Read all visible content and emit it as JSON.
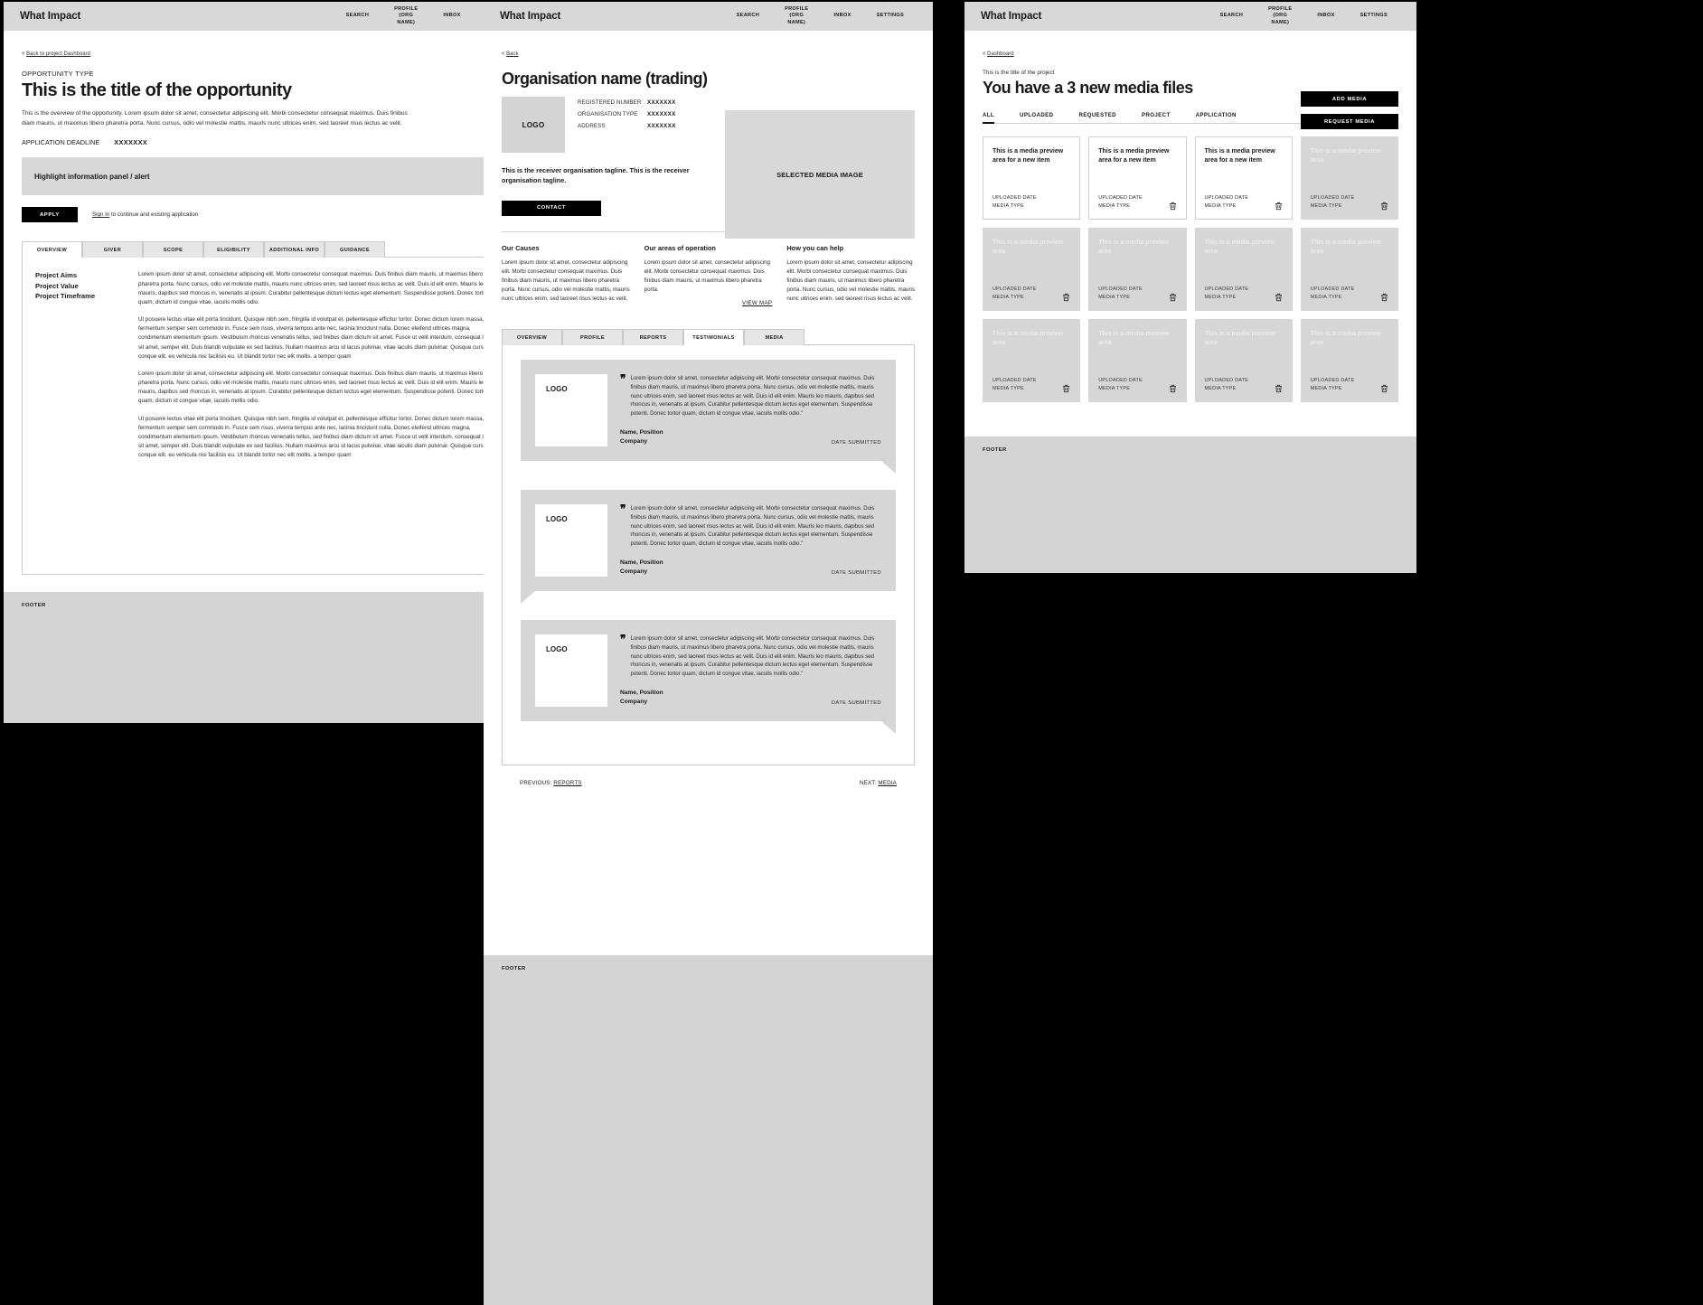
{
  "brand": "What Impact",
  "topnav": [
    "SEARCH",
    "PROFILE\n(ORG\nNAME)",
    "INBOX",
    "SETTINGS"
  ],
  "footer_label": "FOOTER",
  "panel1": {
    "back": "Back to project Dashboard",
    "eyebrow": "OPPORTUNITY TYPE",
    "title": "This is the title of the opportunity",
    "lead": "This is the overview of the opportunity. Lorem ipsum dolor sit amet, consectetur adipiscing elit. Morbi consectetur consequat maximus. Duis finibus diam mauris, ut maximus libero pharetra porta. Nunc cursus, odio vel molestie mattis, mauris nunc ultrices enim, sed laoreet risus lectus ac velit.",
    "deadline_label": "APPLICATION DEADLINE",
    "deadline_value": "XXXXXXX",
    "alert": "Highlight information panel / alert",
    "apply_label": "APPLY",
    "signin_link": "Sign In",
    "signin_rest": " to continue and existing application",
    "tabs": [
      "OVERVIEW",
      "GIVER",
      "SCOPE",
      "ELIGIBILITY",
      "ADDITIONAL INFO",
      "GUIDANCE"
    ],
    "active_tab": "OVERVIEW",
    "labels": [
      "Project Aims",
      "Project Value",
      "Project Timeframe"
    ],
    "paragraphs": [
      "Lorem ipsum dolor sit amet, consectetur adipiscing elit. Morbi consectetur consequat maximus. Duis finibus diam mauris, ut maximus libero pharetra porta. Nunc cursus, odio vel molestie mattis, mauris nunc ultrices enim, sed laoreet risus lectus ac velit. Duis id elit enim. Mauris leo mauris, dapibus sed rhoncus in, venenatis at ipsum. Curabitur pellentesque dictum lectus eget elementum. Suspendisse potenti. Donec tortor quam, dictum id congue vitae, iaculis mollis odio.",
      "Ut posuere lectus vitae elit porta tincidunt. Quisque nibh sem, fringilla id volutpat et, pellentesque efficitur tortor. Donec dictum lorem massa, fermentum semper sem commodo in. Fusce sem risus, viverra tempus ante nec, lacinia tincidunt nulla. Donec eleifend ultrices magna, condimentum elementum ipsum. Vestibulum rhoncus venenatis tellus, sed finibus diam dictum sit amet. Fusce ut velit interdum, consequat lectus sit amet, semper elit. Duis blandit vulputate ex sed facilisis. Nullam maximus arcu id lacus pulvinar, vitae iaculis diam pulvinar. Quisque cursus conque elit. eu vehicula nisi facilisis eu. Ut blandit tortor nec elit mollis. a tempor quam",
      "Lorem ipsum dolor sit amet, consectetur adipiscing elit. Morbi consectetur consequat maximus. Duis finibus diam mauris, ut maximus libero pharetra porta. Nunc cursus, odio vel molestie mattis, mauris nunc ultrices enim, sed laoreet risus lectus ac velit. Duis id elit enim. Mauris leo mauris, dapibus sed rhoncus in, venenatis at ipsum. Curabitur pellentesque dictum lectus eget elementum. Suspendisse potenti. Donec tortor quam, dictum id congue vitae, iaculis mollis odio.",
      "Ut posuere lectus vitae elit porta tincidunt. Quisque nibh sem, fringilla id volutpat et, pellentesque efficitur tortor. Donec dictum lorem massa, fermentum semper sem commodo in. Fusce sem risus, viverra tempus ante nec, lacinia tincidunt nulla. Donec eleifend ultrices magna, condimentum elementum ipsum. Vestibulum rhoncus venenatis tellus, sed finibus diam dictum sit amet. Fusce ut velit interdum, consequat lectus sit amet, semper elit. Duis blandit vulputate ex sed facilisis. Nullam maximus arcu id lacus pulvinar, vitae iaculis diam pulvinar. Quisque cursus conque elit. eu vehicula nisi facilisis eu. Ut blandit tortor nec elit mollis. a tempor quam"
    ]
  },
  "panel2": {
    "back": "Back",
    "title": "Organisation name (trading)",
    "logo_label": "LOGO",
    "meta": [
      {
        "key": "REGISTERED NUMBER",
        "value": "XXXXXXX"
      },
      {
        "key": "ORGANISATION TYPE",
        "value": "XXXXXXX"
      },
      {
        "key": "ADDRESS",
        "value": "XXXXXXX"
      }
    ],
    "media_image_label": "SELECTED MEDIA IMAGE",
    "tagline": "This is the receiver organisation tagline. This is the receiver organisation tagline.",
    "contact_label": "CONTACT",
    "columns": [
      {
        "heading": "Our Causes",
        "body": "Lorem ipsum dolor sit amet, consectetur adipiscing elit. Morbi consectetur consequat maximus. Duis finibus diam mauris, ut maximus libero pharetra porta. Nunc cursus, odio vel molestie mattis, mauris nunc ultrices enim, sed laoreet risus lectus ac velit."
      },
      {
        "heading": "Our areas of operation",
        "body": "Lorem ipsum dolor sit amet, consectetur adipiscing elit. Morbi consectetur consequat maximus. Duis finibus diam mauris, ut maximus libero pharetra porta.",
        "link": "VIEW MAP"
      },
      {
        "heading": "How you can help",
        "body": "Lorem ipsum dolor sit amet, consectetur adipiscing elit. Morbi consectetur consequat maximus. Duis finibus diam mauris, ut maximus libero pharetra porta. Nunc cursus, odio vel molestie mattis, mauris nunc ultrices enim, sed laoreet risus lectus ac velit."
      }
    ],
    "tabs": [
      "OVERVIEW",
      "PROFILE",
      "REPORTS",
      "TESTIMONIALS",
      "MEDIA"
    ],
    "active_tab": "TESTIMONIALS",
    "testimonial_quote": "Lorem ipsum dolor sit amet, consectetur adipiscing elit. Morbi consectetur consequat maximus. Duis finibus diam mauris, ut maximus libero pharetra porta. Nunc cursus, odio vel molestie mattis, mauris nunc ultrices enim, sed laoreet risus lectus ac velit. Duis id elit enim. Mauris leo mauris, dapibus sed rhoncus in, venenatis at ipsum. Curabitur pellentesque dictum lectus eget elementum. Suspendisse potenti. Donec tortor quam, dictum id congue vitae, iaculis mollis odio.\"",
    "testimonials": [
      {
        "logo": "LOGO",
        "name": "Name, Position",
        "company": "Company",
        "date": "DATE SUBMITTED",
        "tail": "right"
      },
      {
        "logo": "LOGO",
        "name": "Name, Position",
        "company": "Company",
        "date": "DATE SUBMITTED",
        "tail": "left"
      },
      {
        "logo": "LOGO",
        "name": "Name, Position",
        "company": "Company",
        "date": "DATE SUBMITTED",
        "tail": "right"
      }
    ],
    "prev_label": "PREVIOUS:",
    "prev_link": "REPORTS",
    "next_label": "NEXT:",
    "next_link": "MEDIA"
  },
  "panel3": {
    "back": "Dashboard",
    "subtitle": "This is the title of the project",
    "title": "You have a 3 new media files",
    "add_media_label": "ADD MEDIA",
    "request_media_label": "REQUEST MEDIA",
    "filters": [
      "ALL",
      "UPLOADED",
      "REQUESTED",
      "PROJECT",
      "APPLICATION"
    ],
    "active_filter": "ALL",
    "card_title": "This is a media preview area for a new item",
    "ghost_title": "This is a media preview area",
    "uploaded_date": "UPLOADED DATE",
    "media_type": "MEDIA TYPE",
    "cards": [
      {
        "ghost": false,
        "trash": false
      },
      {
        "ghost": false,
        "trash": true
      },
      {
        "ghost": false,
        "trash": true
      },
      {
        "ghost": true,
        "trash": true
      },
      {
        "ghost": true,
        "trash": true
      },
      {
        "ghost": true,
        "trash": true
      },
      {
        "ghost": true,
        "trash": true
      },
      {
        "ghost": true,
        "trash": true
      },
      {
        "ghost": true,
        "trash": true
      },
      {
        "ghost": true,
        "trash": true
      },
      {
        "ghost": true,
        "trash": true
      },
      {
        "ghost": true,
        "trash": true
      }
    ]
  }
}
